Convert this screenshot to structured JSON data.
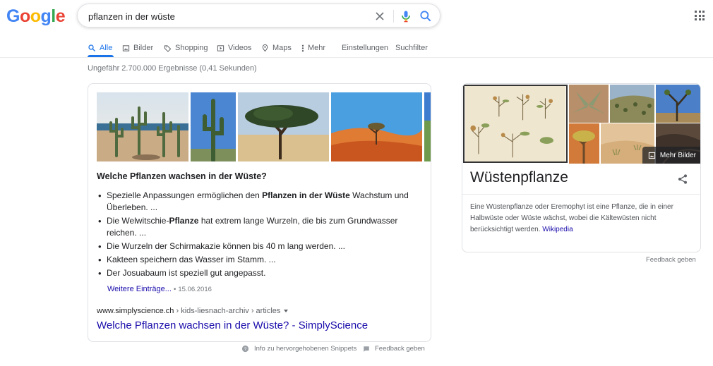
{
  "logo": "Google",
  "search": {
    "query": "pflanzen in der wüste"
  },
  "tabs": [
    {
      "label": "Alle",
      "icon": "search-icon"
    },
    {
      "label": "Bilder",
      "icon": "image-icon"
    },
    {
      "label": "Shopping",
      "icon": "tag-icon"
    },
    {
      "label": "Videos",
      "icon": "play-icon"
    },
    {
      "label": "Maps",
      "icon": "map-pin-icon"
    },
    {
      "label": "Mehr",
      "icon": "more-vertical-icon"
    },
    {
      "label": "Einstellungen"
    },
    {
      "label": "Suchfilter"
    }
  ],
  "stats": "Ungefähr 2.700.000 Ergebnisse (0,41 Sekunden)",
  "snippet": {
    "title": "Welche Pflanzen wachsen in der Wüste?",
    "items": [
      {
        "before": "Spezielle Anpassungen ermöglichen den ",
        "bold": "Pflanzen in der Wüste",
        "after": " Wachstum und Überleben. ..."
      },
      {
        "before": "Die Welwitschie-",
        "bold": "Pflanze",
        "after": " hat extrem lange Wurzeln, die bis zum Grundwasser reichen. ..."
      },
      {
        "before": "Die Wurzeln der Schirmakazie können bis 40 m lang werden. ...",
        "bold": "",
        "after": ""
      },
      {
        "before": "Kakteen speichern das Wasser im Stamm. ...",
        "bold": "",
        "after": ""
      },
      {
        "before": "Der Josuabaum ist speziell gut angepasst.",
        "bold": "",
        "after": ""
      }
    ],
    "more_link": "Weitere Einträge...",
    "bullet_sep": "•",
    "date": "15.06.2016",
    "cite_domain": "www.simplyscience.ch",
    "cite_path": " › kids-liesnach-archiv › articles",
    "result_title": "Welche Pflanzen wachsen in der Wüste? - SimplyScience",
    "footer_info": "Info zu hervorgehobenen Snippets",
    "footer_feedback": "Feedback geben"
  },
  "knowledge_panel": {
    "more_images": "Mehr Bilder",
    "title": "Wüstenpflanze",
    "description": "Eine Wüstenpflanze oder Eremophyt ist eine Pflanze, die in einer Halbwüste oder Wüste wächst, wobei die Kältewüsten nicht berücksichtigt werden.",
    "source": "Wikipedia",
    "feedback": "Feedback geben"
  },
  "colors": {
    "accent": "#1a73e8",
    "link": "#1a0dab",
    "muted": "#70757a"
  }
}
